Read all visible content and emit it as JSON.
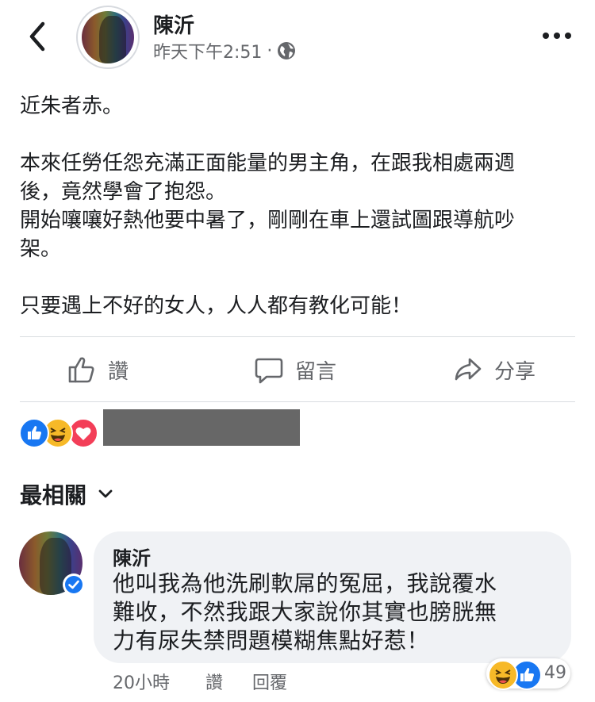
{
  "header": {
    "author_name": "陳沂",
    "timestamp": "昨天下午2:51",
    "separator": "·",
    "privacy_icon": "globe-icon",
    "back_icon": "chevron-left-icon",
    "more_icon": "more-horizontal-icon"
  },
  "post": {
    "lines": [
      "近朱者赤。",
      "",
      "本來任勞任怨充滿正面能量的男主角，在跟我相處兩週",
      "後，竟然學會了抱怨。",
      "開始嚷嚷好熱他要中暑了，剛剛在車上還試圖跟導航吵",
      "架。",
      "",
      "只要遇上不好的女人，人人都有教化可能！"
    ]
  },
  "actions": {
    "like_label": "讚",
    "comment_label": "留言",
    "share_label": "分享"
  },
  "reactions": {
    "types": [
      "like",
      "haha",
      "love"
    ],
    "colors": {
      "like": "#1877f2",
      "haha": "#f7b928",
      "love": "#f33e58"
    }
  },
  "comments_section": {
    "sort_label": "最相關"
  },
  "comment": {
    "author": "陳沂",
    "lines": [
      "他叫我為他洗刷軟屌的冤屈，我說覆水",
      "難收，不然我跟大家說你其實也膀胱無",
      "力有尿失禁問題模糊焦點好惹！"
    ],
    "time": "20小時",
    "like_label": "讚",
    "reply_label": "回覆",
    "reaction_count": "49"
  }
}
